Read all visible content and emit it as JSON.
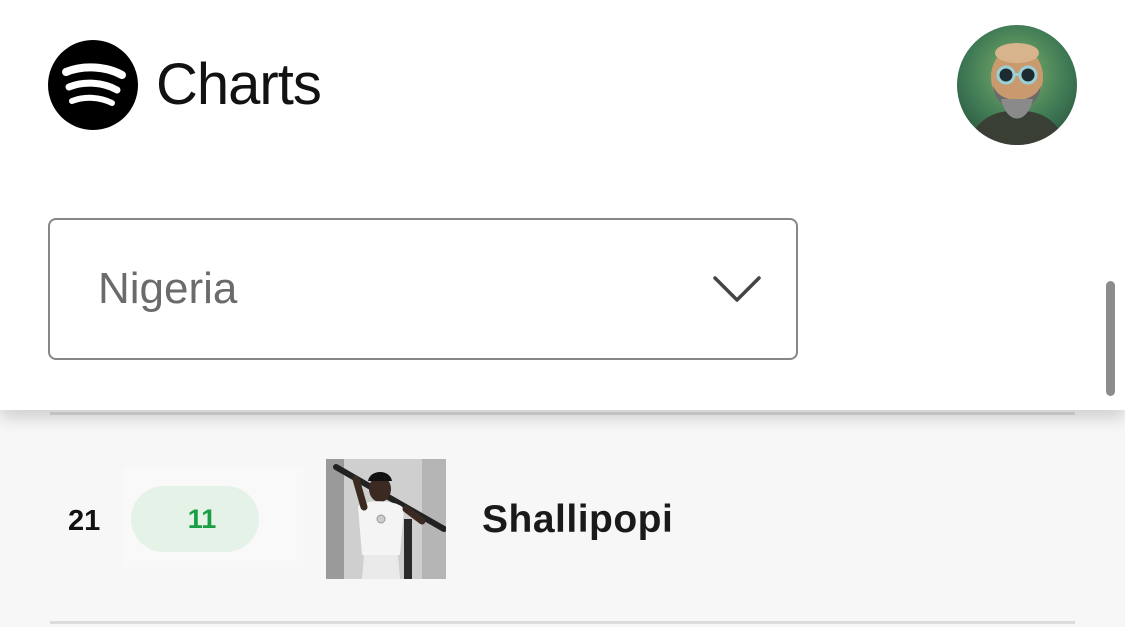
{
  "header": {
    "title": "Charts",
    "logo_icon": "spotify-icon",
    "avatar_icon": "user-avatar"
  },
  "filter": {
    "country": "Nigeria",
    "dropdown_icon": "chevron-down-icon"
  },
  "entries": [
    {
      "rank": "21",
      "movement": "11",
      "movement_direction": "up",
      "movement_icon": "arrow-up-icon",
      "artist": "Shallipopi"
    }
  ],
  "colors": {
    "brand": "#000000",
    "up_text": "#1a9e45",
    "up_bg": "#e4f2e8"
  }
}
